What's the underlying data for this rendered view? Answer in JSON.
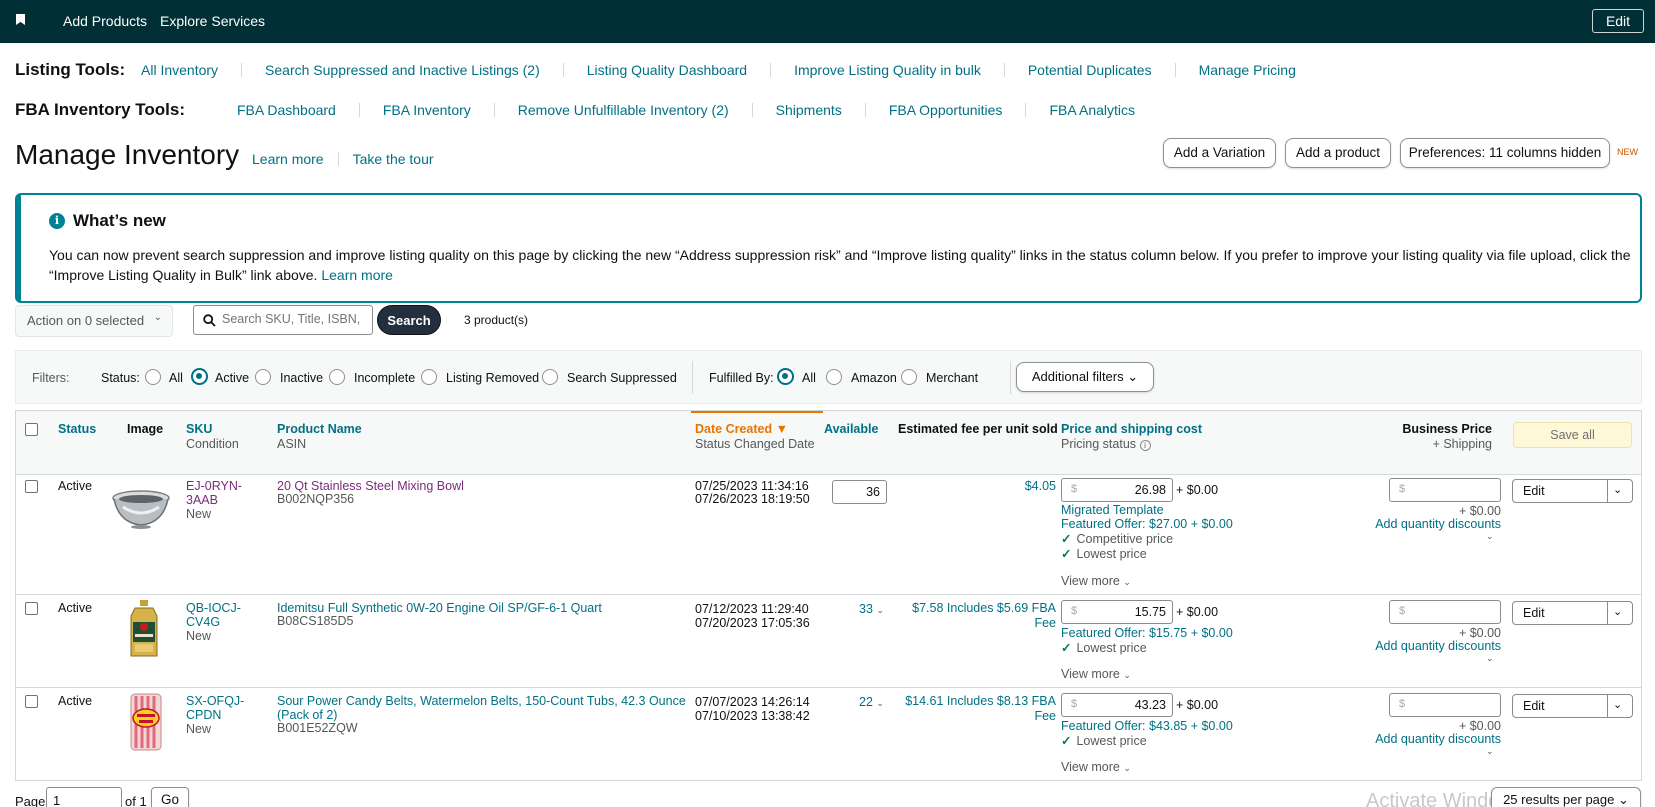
{
  "topbar": {
    "add_products": "Add Products",
    "explore_services": "Explore Services",
    "edit": "Edit"
  },
  "listing_tools": {
    "title": "Listing Tools:",
    "links": [
      "All Inventory",
      "Search Suppressed and Inactive Listings (2)",
      "Listing Quality Dashboard",
      "Improve Listing Quality in bulk",
      "Potential Duplicates",
      "Manage Pricing"
    ]
  },
  "fba_tools": {
    "title": "FBA Inventory Tools:",
    "links": [
      "FBA Dashboard",
      "FBA Inventory",
      "Remove Unfulfillable Inventory (2)",
      "Shipments",
      "FBA Opportunities",
      "FBA Analytics"
    ]
  },
  "header": {
    "title": "Manage Inventory",
    "learn_more": "Learn more",
    "take_tour": "Take the tour",
    "add_variation": "Add a Variation",
    "add_product": "Add a product",
    "preferences": "Preferences: 11 columns hidden",
    "new_badge": "NEW"
  },
  "whats_new": {
    "title": "What’s new",
    "body": "You can now prevent search suppression and improve listing quality on this page by clicking the new “Address suppression risk” and “Improve listing quality” links in the status column below. If you prefer to improve your listing quality via file upload, click the “Improve Listing Quality in Bulk” link above.",
    "learn_more": "Learn more"
  },
  "search": {
    "action_label": "Action on 0 selected",
    "placeholder": "Search SKU, Title, ISBN,",
    "button": "Search",
    "count": "3 product(s)"
  },
  "filters": {
    "label": "Filters:",
    "status_label": "Status:",
    "status_options": [
      "All",
      "Active",
      "Inactive",
      "Incomplete",
      "Listing Removed",
      "Search Suppressed"
    ],
    "status_selected": "Active",
    "fulfilled_label": "Fulfilled By:",
    "fulfilled_options": [
      "All",
      "Amazon",
      "Merchant"
    ],
    "fulfilled_selected": "All",
    "additional": "Additional filters"
  },
  "table": {
    "headers": {
      "status": "Status",
      "image": "Image",
      "sku": "SKU",
      "condition": "Condition",
      "product_name": "Product Name",
      "asin": "ASIN",
      "date_created": "Date Created",
      "status_changed": "Status Changed Date",
      "available": "Available",
      "est_fee": "Estimated fee per unit sold",
      "price_shipping": "Price and shipping cost",
      "pricing_status": "Pricing status",
      "business_price": "Business Price",
      "plus_shipping": "+ Shipping",
      "save_all": "Save all"
    },
    "rows": [
      {
        "status": "Active",
        "sku": "EJ-0RYN-3AAB",
        "condition": "New",
        "name": "20 Qt Stainless Steel Mixing Bowl",
        "asin": "B002NQP356",
        "created": "07/25/2023 11:34:16",
        "changed": "07/26/2023 18:19:50",
        "available": "36",
        "fee": "$4.05",
        "fee2": "",
        "price": "26.98",
        "ship": "+ $0.00",
        "migrated": "Migrated Template",
        "featured": "Featured Offer: $27.00 + $0.00",
        "checks": [
          "Competitive price",
          "Lowest price"
        ],
        "view_more": "View more",
        "biz_ship": "+ $0.00",
        "qty_disc": "Add quantity discounts",
        "edit": "Edit"
      },
      {
        "status": "Active",
        "sku": "QB-IOCJ-CV4G",
        "condition": "New",
        "name": "Idemitsu Full Synthetic 0W-20 Engine Oil SP/GF-6-1 Quart",
        "asin": "B08CS185D5",
        "created": "07/12/2023 11:29:40",
        "changed": "07/20/2023 17:05:36",
        "available": "33",
        "fee": "$7.58 Includes $5.69 FBA",
        "fee2": "Fee",
        "price": "15.75",
        "ship": "+ $0.00",
        "migrated": "",
        "featured": "Featured Offer: $15.75 + $0.00",
        "checks": [
          "Lowest price"
        ],
        "view_more": "View more",
        "biz_ship": "+ $0.00",
        "qty_disc": "Add quantity discounts",
        "edit": "Edit"
      },
      {
        "status": "Active",
        "sku": "SX-OFQJ-CPDN",
        "condition": "New",
        "name": "Sour Power Candy Belts, Watermelon Belts, 150-Count Tubs, 42.3 Ounce (Pack of 2)",
        "asin": "B001E52ZQW",
        "created": "07/07/2023 14:26:14",
        "changed": "07/10/2023 13:38:42",
        "available": "22",
        "fee": "$14.61 Includes $8.13 FBA",
        "fee2": "Fee",
        "price": "43.23",
        "ship": "+ $0.00",
        "migrated": "",
        "featured": "Featured Offer: $43.85 + $0.00",
        "checks": [
          "Lowest price"
        ],
        "view_more": "View more",
        "biz_ship": "+ $0.00",
        "qty_disc": "Add quantity discounts",
        "edit": "Edit"
      }
    ]
  },
  "pagination": {
    "page_label": "Page",
    "page_value": "1",
    "of": "of 1",
    "go": "Go",
    "results": "25 results per page"
  },
  "watermark": "Activate Windo"
}
